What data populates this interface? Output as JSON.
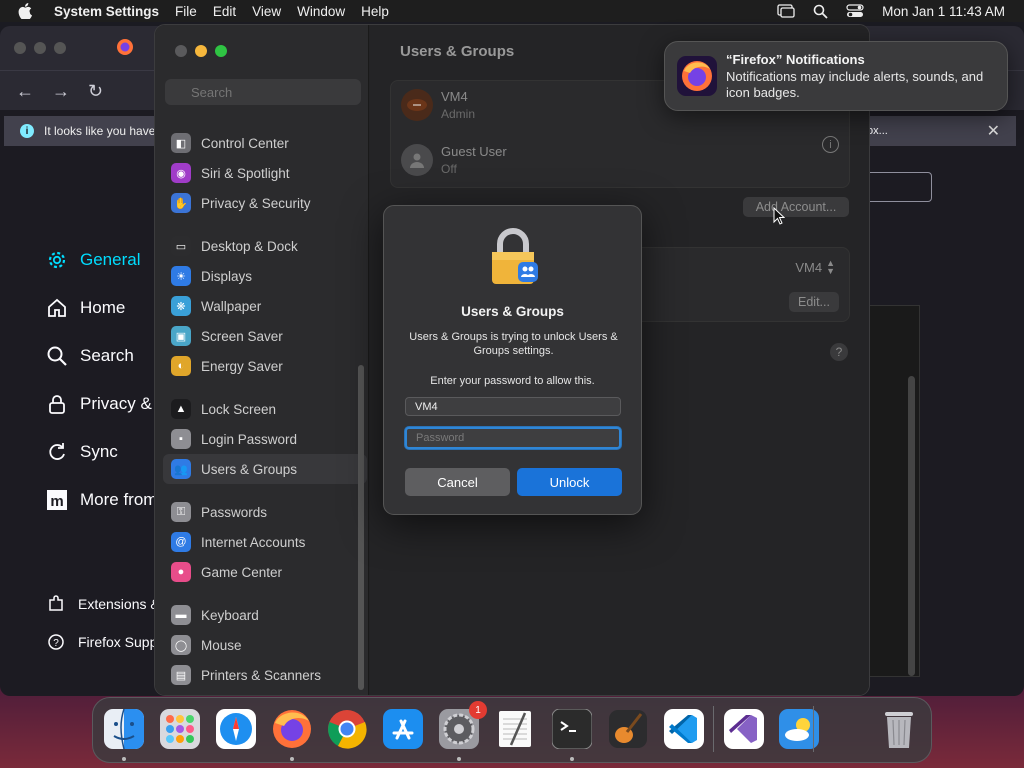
{
  "menubar": {
    "app_name": "System Settings",
    "menus": [
      "File",
      "Edit",
      "View",
      "Window",
      "Help"
    ],
    "clock": "Mon Jan 1  11:43 AM"
  },
  "firefox": {
    "info_bar_text": "It looks like you have",
    "info_bar_button": "fox...",
    "sidebar": [
      {
        "label": "General",
        "icon": "gear-icon",
        "active": true
      },
      {
        "label": "Home",
        "icon": "home-icon"
      },
      {
        "label": "Search",
        "icon": "search-icon"
      },
      {
        "label": "Privacy &",
        "icon": "lock-icon"
      },
      {
        "label": "Sync",
        "icon": "sync-icon"
      },
      {
        "label": "More from",
        "icon": "mozilla-icon"
      }
    ],
    "footer": [
      {
        "label": "Extensions &",
        "icon": "puzzle-icon"
      },
      {
        "label": "Firefox Supp",
        "icon": "help-icon"
      }
    ]
  },
  "settings": {
    "search_placeholder": "Search",
    "sidebar": [
      {
        "label": "Control Center",
        "color": "#6e6e73"
      },
      {
        "label": "Siri & Spotlight",
        "color": "#a03cc8"
      },
      {
        "label": "Privacy & Security",
        "color": "#3b74d6"
      },
      {
        "gap": true
      },
      {
        "label": "Desktop & Dock",
        "color": "#2c2c2e"
      },
      {
        "label": "Displays",
        "color": "#2f7be5"
      },
      {
        "label": "Wallpaper",
        "color": "#3aa0d8"
      },
      {
        "label": "Screen Saver",
        "color": "#4aa6c8"
      },
      {
        "label": "Energy Saver",
        "color": "#e0a62a"
      },
      {
        "gap": true
      },
      {
        "label": "Lock Screen",
        "color": "#1c1c1e"
      },
      {
        "label": "Login Password",
        "color": "#8e8e93"
      },
      {
        "label": "Users & Groups",
        "color": "#2f7be5",
        "selected": true
      },
      {
        "gap": true
      },
      {
        "label": "Passwords",
        "color": "#8e8e93"
      },
      {
        "label": "Internet Accounts",
        "color": "#2f7be5"
      },
      {
        "label": "Game Center",
        "color": "#e84d8a"
      },
      {
        "gap": true
      },
      {
        "label": "Keyboard",
        "color": "#8e8e93"
      },
      {
        "label": "Mouse",
        "color": "#8e8e93"
      },
      {
        "label": "Printers & Scanners",
        "color": "#8e8e93"
      }
    ],
    "title": "Users & Groups",
    "users": [
      {
        "name": "VM4",
        "role": "Admin"
      },
      {
        "name": "Guest User",
        "role": "Off"
      }
    ],
    "add_account_button": "Add Account...",
    "auto_login_value": "VM4",
    "edit_button": "Edit...",
    "help_label": "?"
  },
  "dialog": {
    "title": "Users & Groups",
    "message": "Users & Groups is trying to unlock Users & Groups settings.",
    "prompt": "Enter your password to allow this.",
    "username_value": "VM4",
    "password_placeholder": "Password",
    "cancel_label": "Cancel",
    "unlock_label": "Unlock"
  },
  "notification": {
    "title": "“Firefox” Notifications",
    "body": "Notifications may include alerts, sounds, and icon badges."
  },
  "dock": {
    "apps": [
      {
        "name": "Finder",
        "icon": "finder-icon",
        "running": true
      },
      {
        "name": "Launchpad",
        "icon": "launchpad-icon"
      },
      {
        "name": "Safari",
        "icon": "safari-icon"
      },
      {
        "name": "Firefox",
        "icon": "firefox-icon",
        "running": true
      },
      {
        "name": "Chrome",
        "icon": "chrome-icon"
      },
      {
        "name": "App Store",
        "icon": "app-store-icon"
      },
      {
        "name": "System Settings",
        "icon": "system-settings-icon",
        "running": true,
        "badge": "1"
      },
      {
        "name": "TextEdit",
        "icon": "textedit-icon"
      },
      {
        "name": "Terminal",
        "icon": "terminal-icon",
        "running": true
      },
      {
        "name": "GarageBand",
        "icon": "garageband-icon"
      },
      {
        "name": "VS Code",
        "icon": "vscode-icon"
      },
      {
        "name": "Visual Studio",
        "icon": "visual-studio-icon"
      },
      {
        "name": "Weather",
        "icon": "weather-icon"
      },
      {
        "name": "Trash",
        "icon": "trash-icon"
      }
    ]
  }
}
